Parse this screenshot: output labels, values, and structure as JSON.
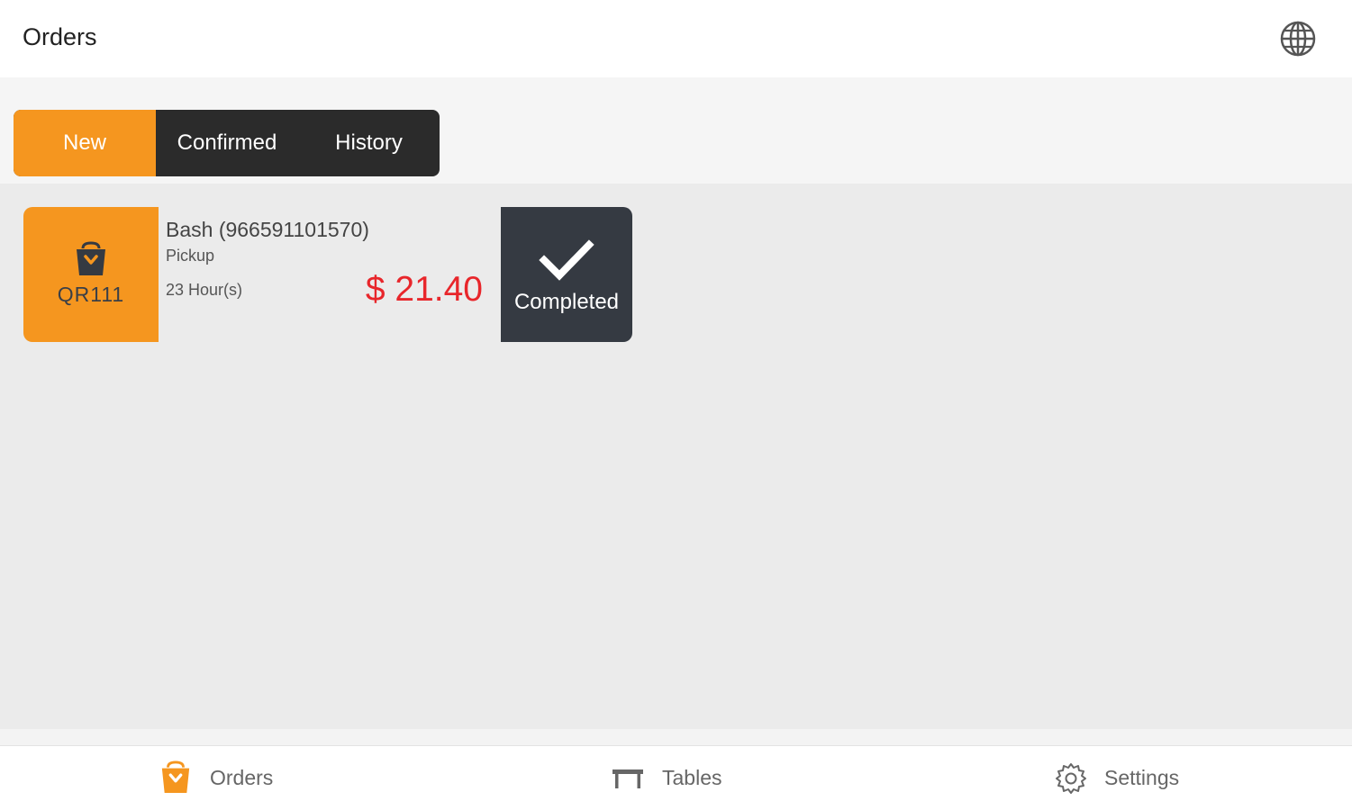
{
  "header": {
    "title": "Orders",
    "globe_icon": "globe-icon"
  },
  "tabs": [
    {
      "label": "New",
      "active": true
    },
    {
      "label": "Confirmed",
      "active": false
    },
    {
      "label": "History",
      "active": false
    }
  ],
  "orders": [
    {
      "code": "QR111",
      "customer": "Bash (966591101570)",
      "type": "Pickup",
      "elapsed": "23 Hour(s)",
      "price": "$ 21.40",
      "action_label": "Completed"
    }
  ],
  "bottom_nav": {
    "orders_label": "Orders",
    "tables_label": "Tables",
    "settings_label": "Settings"
  },
  "colors": {
    "accent": "#f5961f",
    "dark": "#353a42",
    "price": "#e8262b"
  }
}
